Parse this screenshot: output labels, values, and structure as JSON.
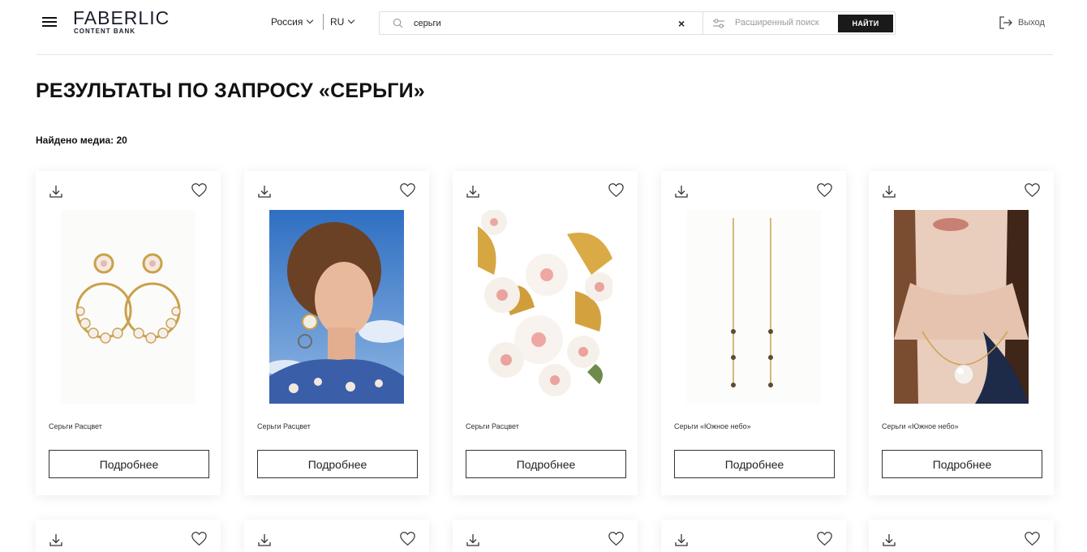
{
  "header": {
    "logo_brand": "FABERLIC",
    "logo_sub": "CONTENT BANK",
    "country": "Россия",
    "language": "RU",
    "search_value": "серьги",
    "clear_symbol": "×",
    "advanced_search": "Расширенный поиск",
    "find_button": "НАЙТИ",
    "logout": "Выход"
  },
  "page": {
    "title": "РЕЗУЛЬТАТЫ ПО ЗАПРОСУ «СЕРЬГИ»",
    "found_count": "Найдено медиа: 20"
  },
  "cards": [
    {
      "name": "Серьги Расцвет",
      "button": "Подробнее",
      "image": "gold-floral-hoop-earrings"
    },
    {
      "name": "Серьги Расцвет",
      "button": "Подробнее",
      "image": "model-wearing-earrings"
    },
    {
      "name": "Серьги Расцвет",
      "button": "Подробнее",
      "image": "white-pink-flowers-closeup"
    },
    {
      "name": "Серьги «Южное небо»",
      "button": "Подробнее",
      "image": "gold-threader-earrings"
    },
    {
      "name": "Серьги «Южное небо»",
      "button": "Подробнее",
      "image": "pearl-pendant-necklace-model"
    }
  ],
  "icons": {
    "menu": "menu-icon",
    "search": "search-icon",
    "filter": "filter-sliders-icon",
    "logout": "logout-icon",
    "download": "download-icon",
    "favorite": "heart-icon"
  },
  "colors": {
    "text": "#111111",
    "accent_button": "#1a1a1a",
    "border": "#dedede"
  }
}
